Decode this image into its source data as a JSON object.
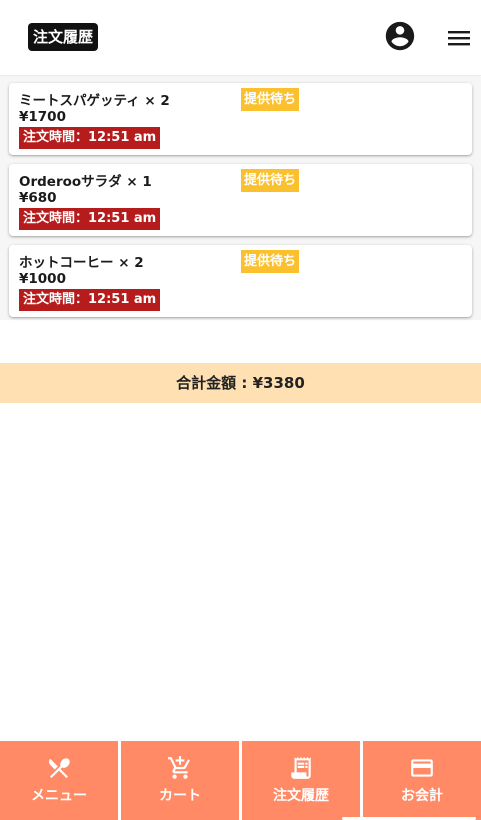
{
  "header": {
    "title": "注文履歴",
    "account_icon": "account-circle-icon",
    "menu_icon": "hamburger-menu-icon"
  },
  "orders": [
    {
      "name": "ミートスパゲッティ × 2",
      "price": "¥1700",
      "time": "注文時間：12:51 am",
      "status": "提供待ち"
    },
    {
      "name": "Orderooサラダ × 1",
      "price": "¥680",
      "time": "注文時間：12:51 am",
      "status": "提供待ち"
    },
    {
      "name": "ホットコーヒー × 2",
      "price": "¥1000",
      "time": "注文時間：12:51 am",
      "status": "提供待ち"
    }
  ],
  "total": {
    "label": "合計金額 : ¥3380"
  },
  "bottom_nav": [
    {
      "label": "メニュー",
      "icon": "fork-knife-icon"
    },
    {
      "label": "カート",
      "icon": "cart-icon"
    },
    {
      "label": "注文履歴",
      "icon": "receipt-icon"
    },
    {
      "label": "お会計",
      "icon": "credit-card-icon"
    }
  ],
  "colors": {
    "nav_bg": "#ff8a65",
    "total_bg": "#ffe0b2",
    "time_badge": "#b71c1c",
    "status_badge": "#fbc02d"
  }
}
